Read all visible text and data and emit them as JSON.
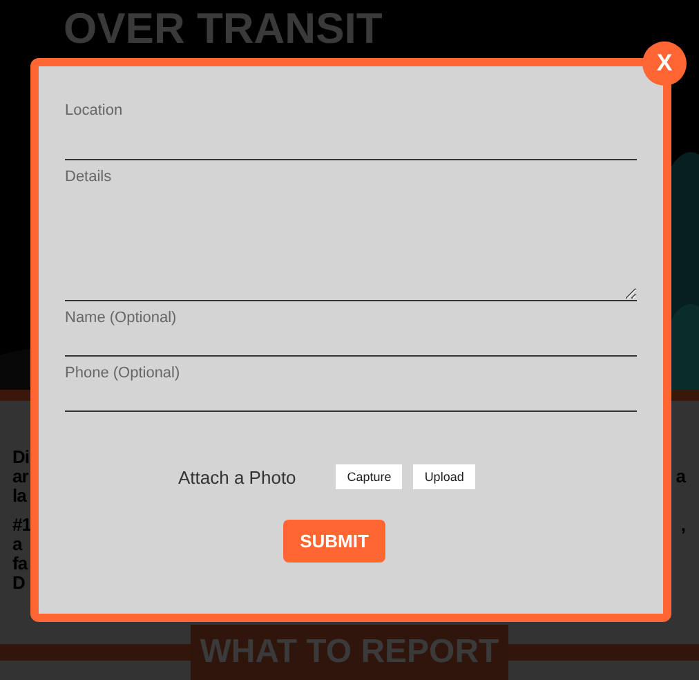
{
  "page": {
    "heading_lines": [
      "OVER TRANSIT"
    ],
    "paragraphs": [
      [
        {
          "left": "Di"
        },
        {
          "left": "ar",
          "right": "a"
        },
        {
          "left": "la"
        }
      ],
      [
        {
          "left": "#1",
          "right": ","
        },
        {
          "left": "a"
        },
        {
          "left": "fa"
        },
        {
          "left": "D"
        }
      ]
    ],
    "section_title": "WHAT TO REPORT"
  },
  "modal": {
    "close": "X",
    "fields": [
      {
        "kind": "input",
        "label": "Location"
      },
      {
        "kind": "textarea",
        "label": "Details"
      },
      {
        "kind": "input",
        "label": "Name (Optional)"
      },
      {
        "kind": "input",
        "label": "Phone (Optional)"
      }
    ],
    "attach_label": "Attach a Photo",
    "attach_buttons": [
      "Capture",
      "Upload"
    ],
    "submit": "SUBMIT"
  }
}
